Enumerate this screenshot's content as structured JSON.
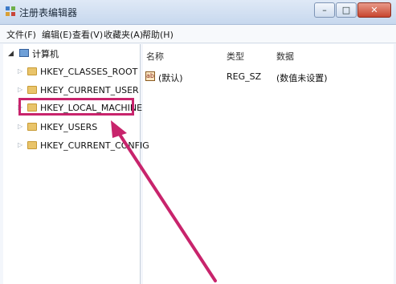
{
  "window": {
    "title": "注册表编辑器",
    "minimize": "–",
    "maximize": "□",
    "close": "✕"
  },
  "menu": [
    "文件(F)",
    "编辑(E)",
    "查看(V)",
    "收藏夹(A)",
    "帮助(H)"
  ],
  "tree": {
    "root_label": "计算机",
    "items": [
      "HKEY_CLASSES_ROOT",
      "HKEY_CURRENT_USER",
      "HKEY_LOCAL_MACHINE",
      "HKEY_USERS",
      "HKEY_CURRENT_CONFIG"
    ],
    "highlighted": "HKEY_LOCAL_MACHINE"
  },
  "list": {
    "columns": [
      "名称",
      "类型",
      "数据"
    ],
    "rows": [
      {
        "name": "(默认)",
        "type": "REG_SZ",
        "data": "(数值未设置)"
      }
    ]
  },
  "colors": {
    "highlight": "#c8246c",
    "arrow": "#c8246c"
  }
}
